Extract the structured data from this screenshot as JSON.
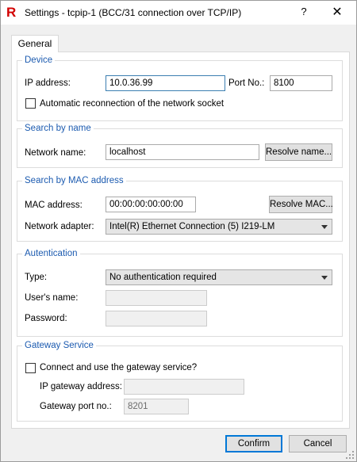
{
  "window": {
    "title": "Settings - tcpip-1 (BCC/31 connection over TCP/IP)",
    "app_icon_letter": "R",
    "help_glyph": "?",
    "close_glyph": "✕"
  },
  "tabs": [
    {
      "label": "General"
    }
  ],
  "device": {
    "group_title": "Device",
    "ip_label": "IP address:",
    "ip_value": "10.0.36.99",
    "port_label": "Port No.:",
    "port_value": "8100",
    "reconnect_label": "Automatic reconnection of the network socket",
    "reconnect_checked": false
  },
  "search_name": {
    "group_title": "Search by name",
    "name_label": "Network name:",
    "name_value": "localhost",
    "resolve_label": "Resolve name..."
  },
  "search_mac": {
    "group_title": "Search by MAC address",
    "mac_label": "MAC address:",
    "mac_value": "00:00:00:00:00:00",
    "resolve_label": "Resolve MAC...",
    "adapter_label": "Network adapter:",
    "adapter_value": "Intel(R) Ethernet Connection (5) I219-LM"
  },
  "auth": {
    "group_title": "Autentication",
    "type_label": "Type:",
    "type_value": "No authentication required",
    "user_label": "User's name:",
    "user_value": "",
    "password_label": "Password:",
    "password_value": ""
  },
  "gateway": {
    "group_title": "Gateway Service",
    "use_label": "Connect and use the gateway service?",
    "use_checked": false,
    "ip_label": "IP gateway address:",
    "ip_value": "",
    "port_label": "Gateway port no.:",
    "port_value": "8201"
  },
  "footer": {
    "confirm_label": "Confirm",
    "cancel_label": "Cancel"
  }
}
